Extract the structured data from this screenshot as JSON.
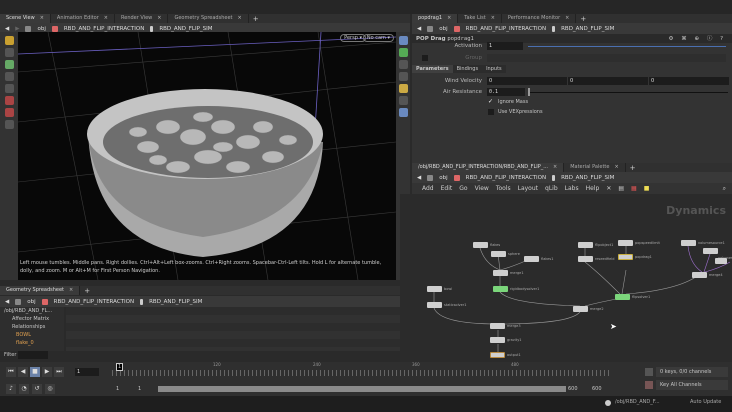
{
  "left_pane": {
    "tabs": [
      {
        "label": "Scene View"
      },
      {
        "label": "Animation Editor"
      },
      {
        "label": "Render View"
      },
      {
        "label": "Geometry Spreadsheet"
      }
    ],
    "path": [
      "obj",
      "RBD_AND_FLIP_INTERACTION",
      "RBD_AND_FLIP_SIM"
    ],
    "viewport": {
      "persp_label": "Persp ▾",
      "cam_label": "No cam ▾",
      "hint": "Left mouse tumbles. Middle pans. Right dollies. Ctrl+Alt+Left box-zooms. Ctrl+Right zooms. Spacebar-Ctrl-Left tilts. Hold L for alternate tumble, dolly, and zoom.    M or Alt+M for First Person Navigation."
    }
  },
  "spreadsheet": {
    "tab": "Geometry Spreadsheet",
    "path": [
      "obj",
      "RBD_AND_FLIP_INTERACTION",
      "RBD_AND_FLIP_SIM"
    ],
    "tree": [
      "/obj/RBD_AND_FL...",
      "Affector Matrix",
      "Relationships",
      "BOWL",
      "flake_0"
    ],
    "filter_label": "Filter"
  },
  "params": {
    "tabs": [
      {
        "label": "popdrag1"
      },
      {
        "label": "Take List"
      },
      {
        "label": "Performance Monitor"
      }
    ],
    "path": [
      "obj",
      "RBD_AND_FLIP_INTERACTION",
      "RBD_AND_FLIP_SIM"
    ],
    "node_type": "POP Drag",
    "node_name": "popdrag1",
    "activation_label": "Activation",
    "activation_value": "1",
    "group_label": "Group",
    "subtabs": [
      "Parameters",
      "Bindings",
      "Inputs"
    ],
    "wind_label": "Wind Velocity",
    "wind_values": [
      "0",
      "0",
      "0"
    ],
    "air_label": "Air Resistance",
    "air_value": "0.1",
    "ignore_mass_label": "Ignore Mass",
    "ignore_mass_checked": true,
    "vex_label": "Use VEXpressions",
    "vex_checked": false
  },
  "network": {
    "tabs": [
      {
        "label": "/obj/RBD_AND_FLIP_INTERACTION/RBD_AND_FLIP_..."
      },
      {
        "label": "Material Palette"
      }
    ],
    "path": [
      "obj",
      "RBD_AND_FLIP_INTERACTION",
      "RBD_AND_FLIP_SIM"
    ],
    "menu": [
      "Add",
      "Edit",
      "Go",
      "View",
      "Tools",
      "Layout",
      "qLib",
      "Labs",
      "Help"
    ],
    "context_label": "Dynamics",
    "nodes": [
      "flakes",
      "sphere",
      "flakes1",
      "merge1",
      "rigidbodysolver1",
      "bowl",
      "staticsolver1",
      "merge3",
      "gravity1",
      "output1",
      "flipobject1",
      "reseedfield",
      "popspeedlimit",
      "popdrag1",
      "flipsolver1",
      "merge2",
      "volumesource1",
      "volumesource2",
      "volumesource3",
      "merge4"
    ]
  },
  "timeline": {
    "current_frame": "1",
    "frame_marker": "1",
    "ticks": [
      "120",
      "240",
      "360",
      "480"
    ],
    "range_start": "1",
    "range_start2": "1",
    "range_end": "600",
    "range_end2": "600",
    "keys_label": "0 keys, 0/0 channels",
    "key_all_label": "Key All Channels"
  },
  "status": {
    "path": "/obj/RBD_AND_F...",
    "update_mode": "Auto Update"
  }
}
